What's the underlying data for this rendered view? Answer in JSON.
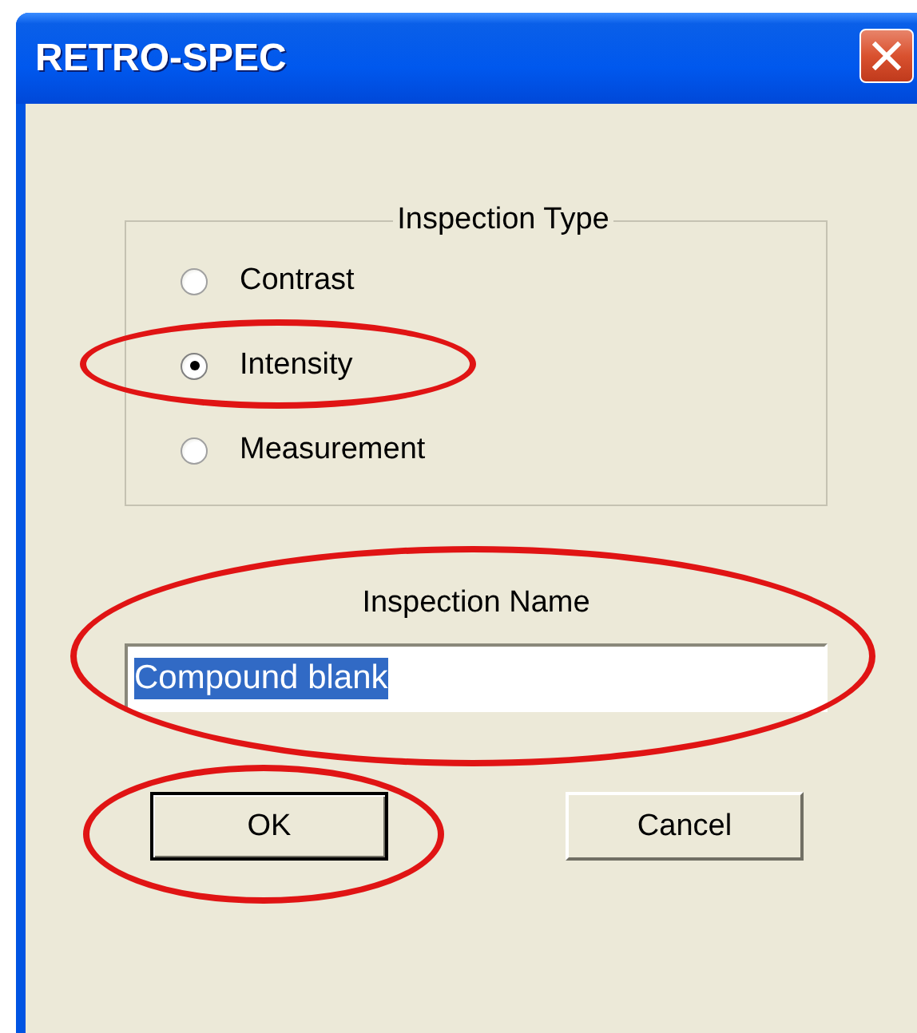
{
  "window": {
    "title": "RETRO-SPEC"
  },
  "inspection_type": {
    "label": "Inspection Type",
    "options": [
      {
        "label": "Contrast",
        "selected": false,
        "circled": false
      },
      {
        "label": "Intensity",
        "selected": true,
        "circled": true
      },
      {
        "label": "Measurement",
        "selected": false,
        "circled": false
      }
    ]
  },
  "inspection_name": {
    "label": "Inspection Name",
    "value": "Compound blank",
    "value_selected": true,
    "circled": true
  },
  "buttons": [
    {
      "label": "OK",
      "default": true,
      "circled": true
    },
    {
      "label": "Cancel",
      "default": false,
      "circled": false
    }
  ]
}
